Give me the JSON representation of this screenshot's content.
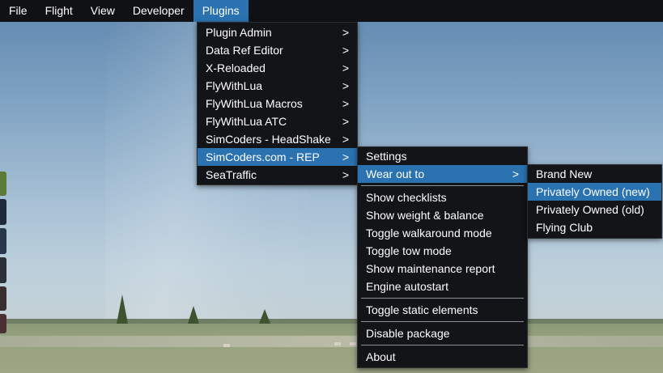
{
  "menubar": {
    "items": [
      {
        "label": "File"
      },
      {
        "label": "Flight"
      },
      {
        "label": "View"
      },
      {
        "label": "Developer"
      },
      {
        "label": "Plugins",
        "active": true
      }
    ]
  },
  "plugins_menu": {
    "items": [
      {
        "label": "Plugin Admin",
        "submenu": true
      },
      {
        "label": "Data Ref Editor",
        "submenu": true
      },
      {
        "label": "X-Reloaded",
        "submenu": true
      },
      {
        "label": "FlyWithLua",
        "submenu": true
      },
      {
        "label": "FlyWithLua Macros",
        "submenu": true
      },
      {
        "label": "FlyWithLua ATC",
        "submenu": true
      },
      {
        "label": "SimCoders - HeadShake",
        "submenu": true
      },
      {
        "label": "SimCoders.com - REP",
        "submenu": true,
        "active": true
      },
      {
        "label": "SeaTraffic",
        "submenu": true
      }
    ],
    "chevron": ">"
  },
  "rep_menu": {
    "items": [
      {
        "label": "Settings"
      },
      {
        "label": "Wear out to",
        "submenu": true,
        "active": true
      },
      {
        "label": "Show checklists"
      },
      {
        "label": "Show weight & balance"
      },
      {
        "label": "Toggle walkaround mode"
      },
      {
        "label": "Toggle tow mode"
      },
      {
        "label": "Show maintenance report"
      },
      {
        "label": "Engine autostart"
      },
      {
        "label": "Toggle static elements"
      },
      {
        "label": "Disable package"
      },
      {
        "label": "About"
      }
    ]
  },
  "wear_menu": {
    "items": [
      {
        "label": "Brand New"
      },
      {
        "label": "Privately Owned (new)",
        "active": true
      },
      {
        "label": "Privately Owned (old)"
      },
      {
        "label": "Flying Club"
      }
    ]
  },
  "colors": {
    "menu_bg": "#121418",
    "highlight": "#2a72b0",
    "text": "#ffffff"
  }
}
